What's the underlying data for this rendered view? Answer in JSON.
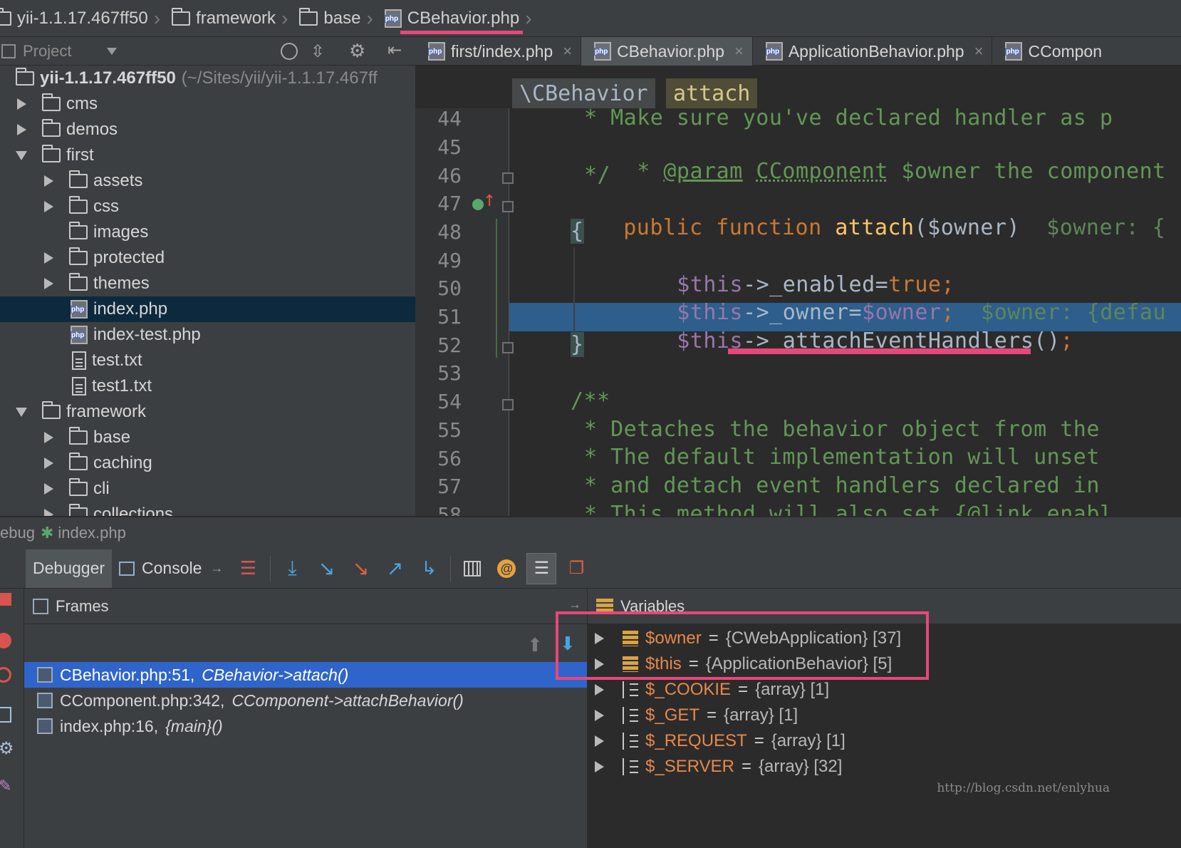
{
  "breadcrumb": {
    "items": [
      {
        "label": "yii-1.1.17.467ff50",
        "icon": "folder-icon"
      },
      {
        "label": "framework",
        "icon": "folder-icon"
      },
      {
        "label": "base",
        "icon": "folder-icon"
      },
      {
        "label": "CBehavior.php",
        "icon": "php-file-icon"
      }
    ],
    "accent_color": "#e8477a"
  },
  "project_panel": {
    "title": "Project",
    "root_label": "yii-1.1.17.467ff50",
    "root_path": "(~/Sites/yii/yii-1.1.17.467ff",
    "items": [
      {
        "label": "cms",
        "kind": "folder",
        "expanded": false
      },
      {
        "label": "demos",
        "kind": "folder",
        "expanded": false
      },
      {
        "label": "first",
        "kind": "folder",
        "expanded": true
      },
      {
        "label": "assets",
        "kind": "folder",
        "expanded": false
      },
      {
        "label": "css",
        "kind": "folder",
        "expanded": false
      },
      {
        "label": "images",
        "kind": "folder",
        "expanded": null
      },
      {
        "label": "protected",
        "kind": "folder",
        "expanded": false
      },
      {
        "label": "themes",
        "kind": "folder",
        "expanded": false
      },
      {
        "label": "index.php",
        "kind": "php",
        "selected": true
      },
      {
        "label": "index-test.php",
        "kind": "php"
      },
      {
        "label": "test.txt",
        "kind": "txt"
      },
      {
        "label": "test1.txt",
        "kind": "txt"
      },
      {
        "label": "framework",
        "kind": "folder",
        "expanded": true
      },
      {
        "label": "base",
        "kind": "folder",
        "expanded": false
      },
      {
        "label": "caching",
        "kind": "folder",
        "expanded": false
      },
      {
        "label": "cli",
        "kind": "folder",
        "expanded": false
      },
      {
        "label": "collections",
        "kind": "folder",
        "expanded": false
      }
    ]
  },
  "editor_tabs": [
    {
      "label": "first/index.php",
      "close": "×"
    },
    {
      "label": "CBehavior.php",
      "close": "×",
      "active": true
    },
    {
      "label": "ApplicationBehavior.php",
      "close": "×"
    },
    {
      "label": "CCompon"
    }
  ],
  "editor": {
    "crumb_class": "\\CBehavior",
    "crumb_method": "attach",
    "line_numbers": [
      "44",
      "45",
      "46",
      "47",
      "48",
      "49",
      "50",
      "51",
      "52",
      "53",
      "54",
      "55",
      "56",
      "57",
      "58"
    ],
    "lines": {
      "l44": "* Make sure you've declared handler as p",
      "l45_star": "* ",
      "l45_tag": "@param",
      "l45_type": "CComponent",
      "l45_rest": " $owner the component",
      "l46": "*/",
      "l47_kw": "public function ",
      "l47_fn": "attach",
      "l47_args": "($owner)",
      "l47_hint": "  $owner: {",
      "l48": "{",
      "l49_var": "$this",
      "l49_rest": "->_enabled=",
      "l49_kw": "true;",
      "l50_var": "$this",
      "l50_rest": "->_owner=",
      "l50_var2": "$owner",
      "l50_semi": ";",
      "l50_hint": "  $owner: {defau",
      "l51_var": "$this",
      "l51_rest": "->_attachEventHandlers()",
      "l51_semi": ";",
      "l52": "}",
      "l54": "/**",
      "l55": "* Detaches the behavior object from the",
      "l56": "* The default implementation will unset",
      "l57": "* and detach event handlers declared in",
      "l58": "* This method will also set {@link enabl"
    }
  },
  "debug": {
    "title_prefix": "ebug",
    "title_file": "index.php",
    "tabs": [
      "Debugger",
      "Console"
    ],
    "frames_title": "Frames",
    "frames": [
      {
        "file": "CBehavior.php:51,",
        "call": "CBehavior->attach()",
        "selected": true
      },
      {
        "file": "CComponent.php:342,",
        "call": "CComponent->attachBehavior()"
      },
      {
        "file": "index.php:16,",
        "call": "{main}()"
      }
    ],
    "variables_title": "Variables",
    "variables": [
      {
        "name": "$owner",
        "value": "{CWebApplication} [37]",
        "kind": "object"
      },
      {
        "name": "$this",
        "value": "{ApplicationBehavior} [5]",
        "kind": "object"
      },
      {
        "name": "$_COOKIE",
        "value": "{array} [1]",
        "kind": "array"
      },
      {
        "name": "$_GET",
        "value": "{array} [1]",
        "kind": "array"
      },
      {
        "name": "$_REQUEST",
        "value": "{array} [1]",
        "kind": "array"
      },
      {
        "name": "$_SERVER",
        "value": "{array} [32]",
        "kind": "array"
      }
    ]
  },
  "watermark": "http://blog.csdn.net/enlyhua"
}
